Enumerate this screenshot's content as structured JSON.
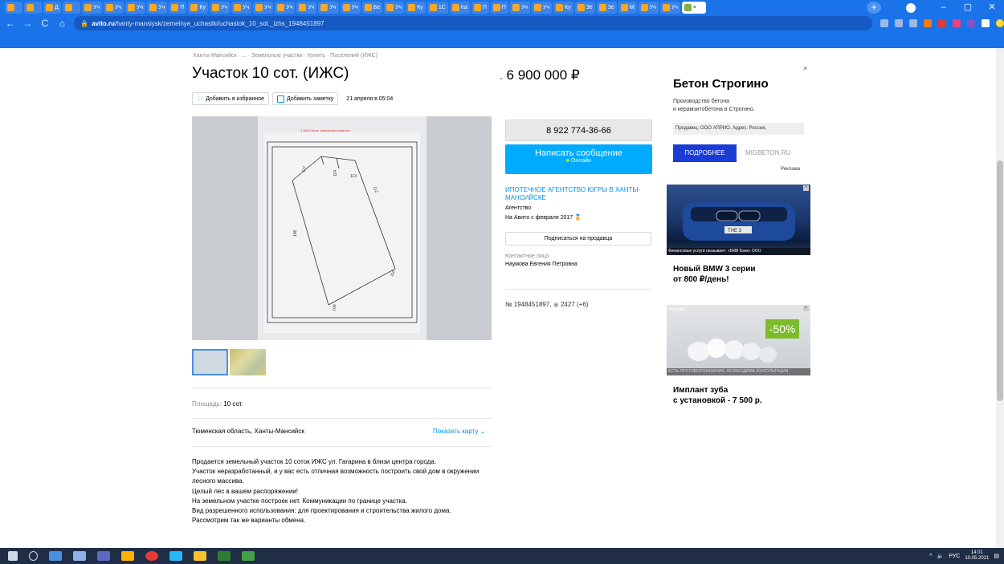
{
  "browser": {
    "tabs": [
      {
        "label": ""
      },
      {
        "label": ""
      },
      {
        "label": "Д"
      },
      {
        "label": ""
      },
      {
        "label": "Уч"
      },
      {
        "label": "Уч"
      },
      {
        "label": "Уч"
      },
      {
        "label": "Уч"
      },
      {
        "label": "П"
      },
      {
        "label": "Ку"
      },
      {
        "label": "Уч"
      },
      {
        "label": "Уч"
      },
      {
        "label": "Уч"
      },
      {
        "label": "Уч"
      },
      {
        "label": "Уч"
      },
      {
        "label": "Уч"
      },
      {
        "label": "Уч"
      },
      {
        "label": "Бе"
      },
      {
        "label": "Уч"
      },
      {
        "label": "Ку"
      },
      {
        "label": "1С"
      },
      {
        "label": "Ка"
      },
      {
        "label": "П"
      },
      {
        "label": "П"
      },
      {
        "label": "Уч"
      },
      {
        "label": "Уч"
      },
      {
        "label": "Ку"
      },
      {
        "label": "Зе"
      },
      {
        "label": "Зе"
      },
      {
        "label": "М"
      },
      {
        "label": "Уч"
      },
      {
        "label": "Уч"
      },
      {
        "label": "×"
      }
    ],
    "new_tab": "+",
    "url_host": "avito.ru",
    "url_path": "/hanty-mansiysk/zemelnye_uchastki/uchastok_10_sot._izhs_1948451897",
    "back": "←",
    "forward": "→",
    "reload": "C",
    "home": "⌂",
    "minimize": "–",
    "maximize": "▢",
    "close": "✕"
  },
  "listing": {
    "breadcrumb": "Ханты-Мансийск · ... · Земельные участки · Купить · Поселений (ИЖС)",
    "title": "Участок 10 сот. (ИЖС)",
    "add_favorite": "Добавить в избранное",
    "add_note": "Добавить заметку",
    "date": "21 апреля в 05:04",
    "photo_caption": "1 000,0 кв.м. земельного участка",
    "area_label": "Площадь:",
    "area_value": "10 сот.",
    "address": "Тюменская область, Ханты-Мансийск",
    "show_map": "Показать карту",
    "description": [
      "Продается земельный участок 10 соток ИЖС ул. Гагарина в близи центра города.",
      "Участок неразработанный, и у вас есть отличная возможность построить свой дом в окружении лесного массива.",
      "Целый лес в вашем распоряжении!",
      "На земельном участке построек нет. Коммуникации по границе участка.",
      "Вид разрешенного использования: для проектирования и строительства жилого дома.",
      "Рассмотрим так же варианты обмена."
    ]
  },
  "seller": {
    "price": "6 900 000 ₽",
    "phone": "8 922 774-36-66",
    "message_button": "Написать сообщение",
    "online": "Онлайн",
    "agency_name": "ИПОТЕЧНОЕ АГЕНТСТВО ЮГРЫ В ХАНТЫ-МАНСИЙСКЕ",
    "agency_type": "Агентство",
    "since": "На Авито с февраля 2017",
    "subscribe": "Подписаться на продавца",
    "contact_label": "Контактное лицо",
    "contact_name": "Наумова Евгения Петровна",
    "ad_number": "№ 1948451897,",
    "views": "2427 (+6)"
  },
  "ads": {
    "close": "×",
    "beton_title": "Бетон Строгино",
    "beton_sub1": "Производство бетона",
    "beton_sub2": "и керамзитобетона в Строгино.",
    "beton_seller": "Продавец: ООО АПРИО. Адрес: Россия, ",
    "beton_more": "ПОДРОБНЕЕ",
    "beton_domain": "MIGBETON.RU",
    "ad_mark": "Реклама",
    "bmw_plate": "THE 3",
    "bmw_caption": "Финансовые услуги оказывает: «БМВ Банк» ООО",
    "bmw_title1": "Новый BMW 3 серии",
    "bmw_title2": "от 800 ₽/день!",
    "tooth_label": "Реклама",
    "tooth_discount": "-50%",
    "tooth_caption": "ЕСТЬ ПРОТИВОПОКАЗАНИЯ, НЕОБХОДИМА КОНСУЛЬТАЦИЯ",
    "tooth_title1": "Имплант зуба",
    "tooth_title2": "с установкой - 7 500 р."
  },
  "taskbar": {
    "lang": "РУС",
    "time": "14:01",
    "date": "10.05.2021"
  },
  "colors": {
    "accent": "#0091ea",
    "message_button": "#00aaff",
    "browser_chrome": "#1a73e8",
    "ad_button": "#1a3bd6"
  }
}
